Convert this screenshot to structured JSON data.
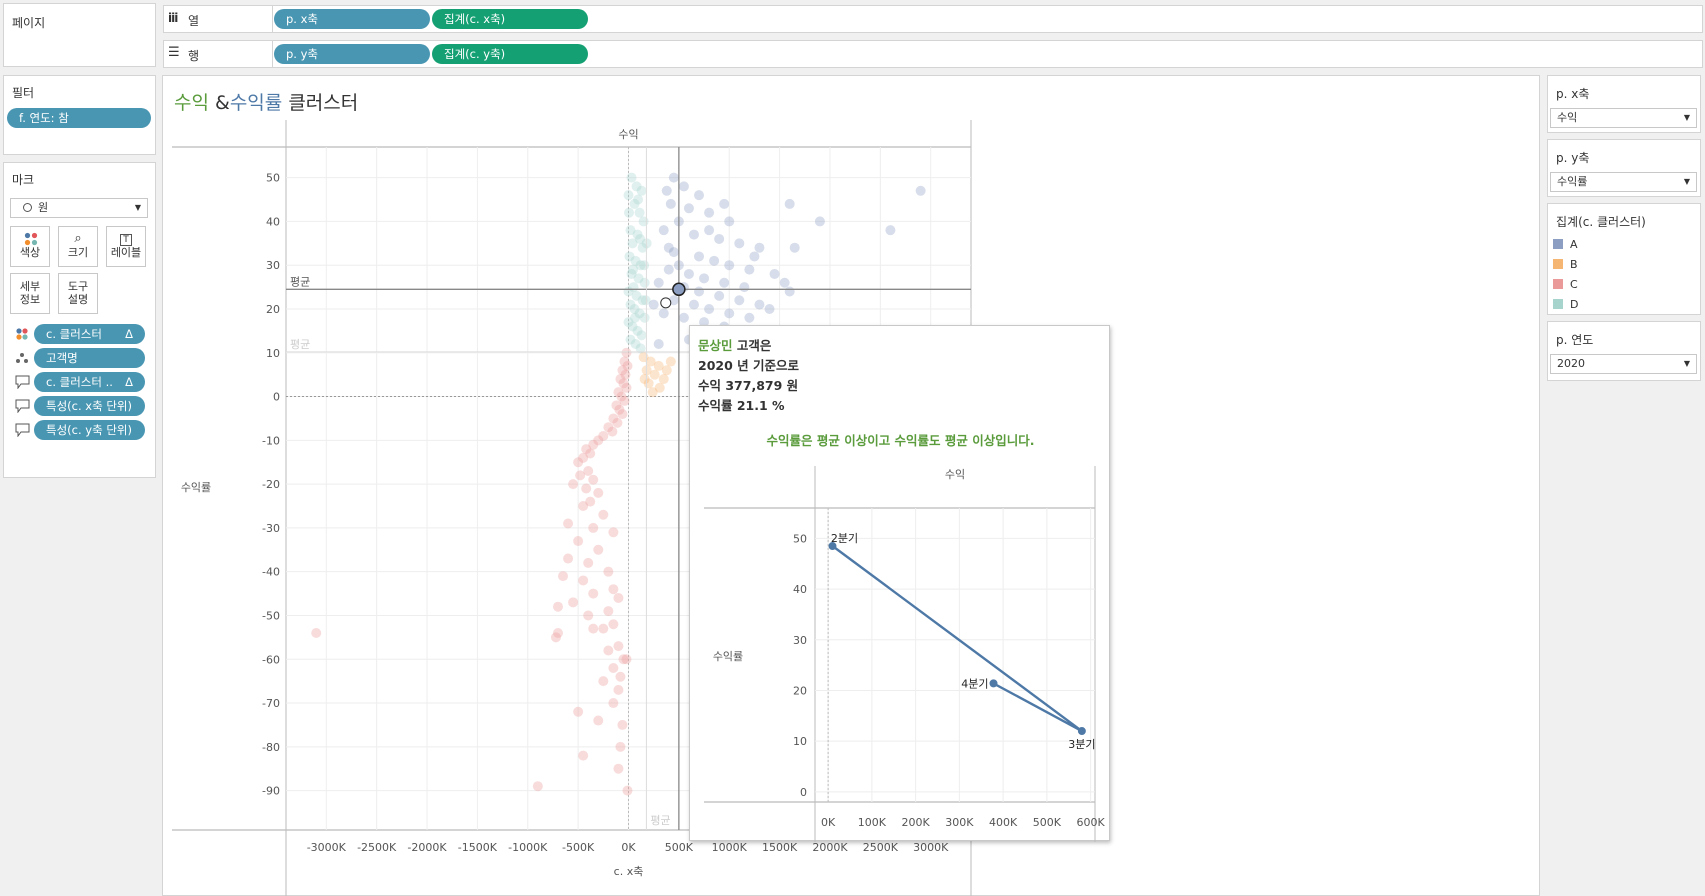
{
  "pages": {
    "title": "페이지"
  },
  "shelves": {
    "columns": {
      "label": "열",
      "pills": [
        "p. x축",
        "집계(c. x축)"
      ]
    },
    "rows": {
      "label": "행",
      "pills": [
        "p. y축",
        "집계(c. y축)"
      ]
    }
  },
  "filters": {
    "title": "필터",
    "pill": "f. 연도: 참"
  },
  "marks": {
    "title": "마크",
    "type": "원",
    "buttons": [
      {
        "label1": "색상",
        "label2": "",
        "icon": "color-icon"
      },
      {
        "label1": "크기",
        "label2": "",
        "icon": "size-icon"
      },
      {
        "label1": "레이블",
        "label2": "",
        "icon": "label-icon"
      },
      {
        "label1": "세부",
        "label2": "정보",
        "icon": ""
      },
      {
        "label1": "도구",
        "label2": "설명",
        "icon": ""
      }
    ],
    "pills": [
      {
        "label": "c. 클러스터",
        "delta": "Δ",
        "icon": "color-icon"
      },
      {
        "label": "고객명",
        "delta": "",
        "icon": "detail-icon"
      },
      {
        "label": "c. 클러스터 ..",
        "delta": "Δ",
        "icon": "tooltip-icon"
      },
      {
        "label": "특성(c. x축 단위)",
        "delta": "",
        "icon": "tooltip-icon"
      },
      {
        "label": "특성(c. y축 단위)",
        "delta": "",
        "icon": "tooltip-icon"
      }
    ]
  },
  "title": {
    "part1": "수익",
    "part2": " &",
    "part3": "수익률",
    "part4": " 클러스터"
  },
  "colors": {
    "green": "#5a9b3c",
    "blue": "#4e79a7",
    "pillBlue": "#4996b2",
    "pillGreen": "#15a073",
    "clusterA": "#8c9fc3",
    "clusterB": "#f5b573",
    "clusterC": "#eb9a9a",
    "clusterD": "#a7d3cd"
  },
  "params": {
    "x": {
      "title": "p. x축",
      "value": "수익"
    },
    "y": {
      "title": "p. y축",
      "value": "수익률"
    },
    "year": {
      "title": "p. 연도",
      "value": "2020"
    }
  },
  "legend": {
    "title": "집계(c. 클러스터)",
    "items": [
      "A",
      "B",
      "C",
      "D"
    ]
  },
  "chart_data": [
    {
      "type": "scatter",
      "top_label": "수익",
      "xlabel": "c. x축",
      "ylabel": "수익률",
      "xlim": [
        -3400,
        3400
      ],
      "ylim": [
        -99,
        57
      ],
      "xticks": [
        -3000,
        -2500,
        -2000,
        -1500,
        -1000,
        -500,
        0,
        500,
        1000,
        1500,
        2000,
        2500,
        3000
      ],
      "xtick_labels": [
        "-3000K",
        "-2500K",
        "-2000K",
        "-1500K",
        "-1000K",
        "-500K",
        "0K",
        "500K",
        "1000K",
        "1500K",
        "2000K",
        "2500K",
        "3000K"
      ],
      "yticks": [
        50,
        40,
        30,
        20,
        10,
        0,
        -10,
        -20,
        -30,
        -40,
        -50,
        -60,
        -70,
        -80,
        -90
      ],
      "avg_lines": {
        "y_avg": 24.5,
        "y_avg2": 10.2,
        "x_avg": 178,
        "label": "평균"
      },
      "highlight": {
        "x": 500,
        "y": 24.5
      },
      "secondary_point": {
        "x": 370,
        "y": 21.4
      },
      "points": [
        [
          30,
          50,
          "D"
        ],
        [
          80,
          48,
          "D"
        ],
        [
          130,
          47,
          "D"
        ],
        [
          0,
          46,
          "D"
        ],
        [
          60,
          44,
          "D"
        ],
        [
          110,
          42,
          "D"
        ],
        [
          150,
          40,
          "D"
        ],
        [
          20,
          38,
          "D"
        ],
        [
          90,
          37,
          "D"
        ],
        [
          40,
          35,
          "D"
        ],
        [
          140,
          34,
          "D"
        ],
        [
          10,
          32,
          "D"
        ],
        [
          70,
          31,
          "D"
        ],
        [
          120,
          30,
          "D"
        ],
        [
          30,
          28,
          "D"
        ],
        [
          100,
          27,
          "D"
        ],
        [
          160,
          26,
          "D"
        ],
        [
          50,
          25,
          "D"
        ],
        [
          0,
          24,
          "D"
        ],
        [
          80,
          23,
          "D"
        ],
        [
          140,
          22,
          "D"
        ],
        [
          20,
          21,
          "D"
        ],
        [
          60,
          20,
          "D"
        ],
        [
          110,
          19,
          "D"
        ],
        [
          160,
          18,
          "D"
        ],
        [
          0,
          17,
          "D"
        ],
        [
          40,
          16,
          "D"
        ],
        [
          90,
          15,
          "D"
        ],
        [
          130,
          14,
          "D"
        ],
        [
          20,
          13,
          "D"
        ],
        [
          70,
          12,
          "D"
        ],
        [
          120,
          11,
          "D"
        ],
        [
          170,
          22,
          "D"
        ],
        [
          180,
          35,
          "D"
        ],
        [
          5,
          42,
          "D"
        ],
        [
          45,
          29,
          "D"
        ],
        [
          95,
          45,
          "D"
        ],
        [
          155,
          30,
          "D"
        ],
        [
          65,
          18,
          "D"
        ],
        [
          115,
          36,
          "D"
        ],
        [
          450,
          50,
          "A"
        ],
        [
          380,
          47,
          "A"
        ],
        [
          550,
          48,
          "A"
        ],
        [
          700,
          46,
          "A"
        ],
        [
          420,
          44,
          "A"
        ],
        [
          600,
          43,
          "A"
        ],
        [
          800,
          42,
          "A"
        ],
        [
          1000,
          40,
          "A"
        ],
        [
          1600,
          44,
          "A"
        ],
        [
          1900,
          40,
          "A"
        ],
        [
          500,
          40,
          "A"
        ],
        [
          350,
          38,
          "A"
        ],
        [
          650,
          37,
          "A"
        ],
        [
          900,
          36,
          "A"
        ],
        [
          1100,
          35,
          "A"
        ],
        [
          1300,
          34,
          "A"
        ],
        [
          1650,
          34,
          "A"
        ],
        [
          450,
          33,
          "A"
        ],
        [
          700,
          32,
          "A"
        ],
        [
          850,
          31,
          "A"
        ],
        [
          1000,
          30,
          "A"
        ],
        [
          1200,
          29,
          "A"
        ],
        [
          1450,
          28,
          "A"
        ],
        [
          400,
          29,
          "A"
        ],
        [
          600,
          28,
          "A"
        ],
        [
          750,
          27,
          "A"
        ],
        [
          950,
          26,
          "A"
        ],
        [
          1150,
          25,
          "A"
        ],
        [
          1550,
          26,
          "A"
        ],
        [
          300,
          26,
          "A"
        ],
        [
          550,
          25,
          "A"
        ],
        [
          700,
          24,
          "A"
        ],
        [
          900,
          23,
          "A"
        ],
        [
          1100,
          22,
          "A"
        ],
        [
          1300,
          21,
          "A"
        ],
        [
          1600,
          24,
          "A"
        ],
        [
          450,
          22,
          "A"
        ],
        [
          650,
          21,
          "A"
        ],
        [
          800,
          20,
          "A"
        ],
        [
          1000,
          19,
          "A"
        ],
        [
          1200,
          18,
          "A"
        ],
        [
          350,
          19,
          "A"
        ],
        [
          550,
          18,
          "A"
        ],
        [
          750,
          17,
          "A"
        ],
        [
          950,
          16,
          "A"
        ],
        [
          1150,
          15,
          "A"
        ],
        [
          2600,
          38,
          "A"
        ],
        [
          2900,
          47,
          "A"
        ],
        [
          1400,
          20,
          "A"
        ],
        [
          850,
          14,
          "A"
        ],
        [
          600,
          13,
          "A"
        ],
        [
          300,
          12,
          "A"
        ],
        [
          1050,
          11,
          "A"
        ],
        [
          400,
          34,
          "A"
        ],
        [
          800,
          38,
          "A"
        ],
        [
          1250,
          32,
          "A"
        ],
        [
          500,
          30,
          "A"
        ],
        [
          950,
          44,
          "A"
        ],
        [
          250,
          21,
          "A"
        ],
        [
          700,
          15,
          "A"
        ],
        [
          150,
          9,
          "B"
        ],
        [
          220,
          8,
          "B"
        ],
        [
          300,
          7,
          "B"
        ],
        [
          180,
          6,
          "B"
        ],
        [
          260,
          5,
          "B"
        ],
        [
          350,
          4,
          "B"
        ],
        [
          200,
          3,
          "B"
        ],
        [
          310,
          2,
          "B"
        ],
        [
          240,
          1,
          "B"
        ],
        [
          380,
          6,
          "B"
        ],
        [
          420,
          8,
          "B"
        ],
        [
          160,
          4,
          "B"
        ],
        [
          -20,
          10,
          "C"
        ],
        [
          -40,
          8,
          "C"
        ],
        [
          -10,
          7,
          "C"
        ],
        [
          -60,
          6,
          "C"
        ],
        [
          -30,
          5,
          "C"
        ],
        [
          -80,
          4,
          "C"
        ],
        [
          -50,
          3,
          "C"
        ],
        [
          -20,
          2,
          "C"
        ],
        [
          -100,
          1,
          "C"
        ],
        [
          -70,
          0,
          "C"
        ],
        [
          -40,
          -1,
          "C"
        ],
        [
          -120,
          -2,
          "C"
        ],
        [
          -90,
          -3,
          "C"
        ],
        [
          -60,
          -4,
          "C"
        ],
        [
          -150,
          -5,
          "C"
        ],
        [
          -110,
          -6,
          "C"
        ],
        [
          -200,
          -7,
          "C"
        ],
        [
          -160,
          -8,
          "C"
        ],
        [
          -250,
          -9,
          "C"
        ],
        [
          -300,
          -10,
          "C"
        ],
        [
          -350,
          -11,
          "C"
        ],
        [
          -420,
          -12,
          "C"
        ],
        [
          -380,
          -13,
          "C"
        ],
        [
          -450,
          -14,
          "C"
        ],
        [
          -500,
          -15,
          "C"
        ],
        [
          -400,
          -17,
          "C"
        ],
        [
          -480,
          -18,
          "C"
        ],
        [
          -350,
          -19,
          "C"
        ],
        [
          -550,
          -20,
          "C"
        ],
        [
          -420,
          -21,
          "C"
        ],
        [
          -300,
          -22,
          "C"
        ],
        [
          -380,
          -24,
          "C"
        ],
        [
          -450,
          -25,
          "C"
        ],
        [
          -250,
          -27,
          "C"
        ],
        [
          -600,
          -29,
          "C"
        ],
        [
          -350,
          -30,
          "C"
        ],
        [
          -150,
          -31,
          "C"
        ],
        [
          -500,
          -33,
          "C"
        ],
        [
          -300,
          -35,
          "C"
        ],
        [
          -600,
          -37,
          "C"
        ],
        [
          -400,
          -38,
          "C"
        ],
        [
          -200,
          -40,
          "C"
        ],
        [
          -450,
          -42,
          "C"
        ],
        [
          -650,
          -41,
          "C"
        ],
        [
          -150,
          -44,
          "C"
        ],
        [
          -350,
          -45,
          "C"
        ],
        [
          -100,
          -46,
          "C"
        ],
        [
          -550,
          -47,
          "C"
        ],
        [
          -200,
          -49,
          "C"
        ],
        [
          -700,
          -48,
          "C"
        ],
        [
          -400,
          -50,
          "C"
        ],
        [
          -150,
          -52,
          "C"
        ],
        [
          -250,
          -53,
          "C"
        ],
        [
          -700,
          -54,
          "C"
        ],
        [
          -350,
          -53,
          "C"
        ],
        [
          -100,
          -57,
          "C"
        ],
        [
          -200,
          -58,
          "C"
        ],
        [
          -50,
          -60,
          "C"
        ],
        [
          -150,
          -62,
          "C"
        ],
        [
          -80,
          -64,
          "C"
        ],
        [
          -100,
          -67,
          "C"
        ],
        [
          -500,
          -72,
          "C"
        ],
        [
          -150,
          -70,
          "C"
        ],
        [
          -300,
          -74,
          "C"
        ],
        [
          -80,
          -80,
          "C"
        ],
        [
          -450,
          -82,
          "C"
        ],
        [
          -100,
          -85,
          "C"
        ],
        [
          -900,
          -89,
          "C"
        ],
        [
          -10,
          -90,
          "C"
        ],
        [
          -3100,
          -54,
          "C"
        ],
        [
          -720,
          -55,
          "C"
        ],
        [
          -20,
          -60,
          "C"
        ],
        [
          -250,
          -65,
          "C"
        ],
        [
          -60,
          -75,
          "C"
        ]
      ]
    },
    {
      "type": "line",
      "top_label": "수익",
      "ylabel": "수익률",
      "xlim": [
        -30,
        610
      ],
      "ylim": [
        -2,
        56
      ],
      "xticks": [
        0,
        100,
        200,
        300,
        400,
        500,
        600
      ],
      "xtick_labels": [
        "0K",
        "100K",
        "200K",
        "300K",
        "400K",
        "500K",
        "600K"
      ],
      "yticks": [
        0,
        10,
        20,
        30,
        40,
        50
      ],
      "points": [
        {
          "label": "2분기",
          "x": 10,
          "y": 48.5
        },
        {
          "label": "3분기",
          "x": 580,
          "y": 12
        },
        {
          "label": "4분기",
          "x": 378,
          "y": 21.4
        }
      ]
    }
  ],
  "tooltip": {
    "customer": "문상민",
    "line1_suffix": " 고객은",
    "line2": "2020 년 기준으로",
    "line3": "수익 377,879 원",
    "line4": "수익률 21.1 %",
    "message": "수익률은 평균 이상이고 수익률도 평균 이상입니다."
  }
}
